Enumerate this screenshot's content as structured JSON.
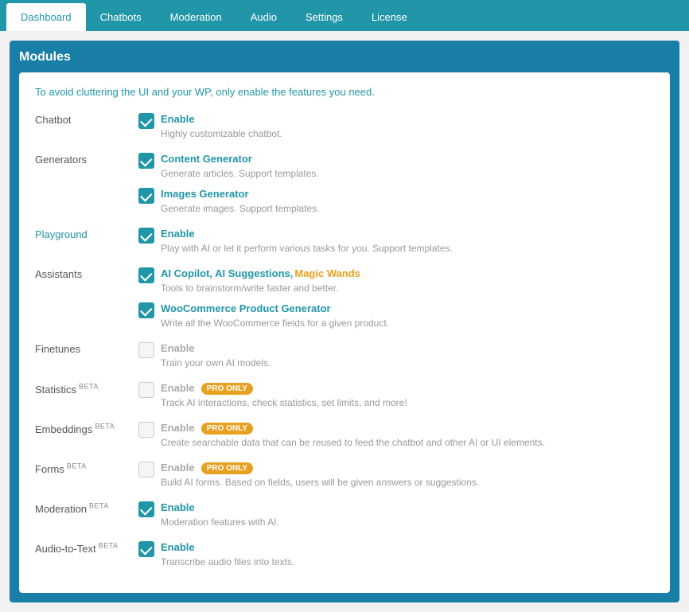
{
  "tabs": [
    {
      "label": "Dashboard",
      "active": false
    },
    {
      "label": "Chatbots",
      "active": false
    },
    {
      "label": "Moderation",
      "active": true
    },
    {
      "label": "Audio",
      "active": false
    },
    {
      "label": "Settings",
      "active": false
    },
    {
      "label": "License",
      "active": false
    }
  ],
  "panel": {
    "title": "Modules",
    "intro": "To avoid cluttering the UI and your WP, only enable the features you need."
  },
  "modules": [
    {
      "id": "chatbot",
      "label": "Chatbot",
      "beta": false,
      "controls": [
        {
          "checked": true,
          "title": "Enable",
          "desc": "Highly customizable chatbot.",
          "pro": false,
          "magic": false
        }
      ]
    },
    {
      "id": "generators",
      "label": "Generators",
      "beta": false,
      "controls": [
        {
          "checked": true,
          "title": "Content Generator",
          "desc": "Generate articles. Support templates.",
          "pro": false,
          "magic": false
        },
        {
          "checked": true,
          "title": "Images Generator",
          "desc": "Generate images. Support templates.",
          "pro": false,
          "magic": false
        }
      ]
    },
    {
      "id": "playground",
      "label": "Playground",
      "beta": false,
      "controls": [
        {
          "checked": true,
          "title": "Enable",
          "desc": "Play with AI or let it perform various tasks for you. Support templates.",
          "pro": false,
          "magic": false
        }
      ]
    },
    {
      "id": "assistants",
      "label": "Assistants",
      "beta": false,
      "controls": [
        {
          "checked": true,
          "title_parts": [
            "AI Copilot, AI Suggestions, ",
            "Magic Wands"
          ],
          "magic_wands": true,
          "desc": "Tools to brainstorm/write faster and better.",
          "pro": false,
          "magic": false
        },
        {
          "checked": true,
          "title": "WooCommerce Product Generator",
          "desc": "Write all the WooCommerce fields for a given product.",
          "pro": false,
          "magic": false
        }
      ]
    },
    {
      "id": "finetunes",
      "label": "Finetunes",
      "beta": false,
      "controls": [
        {
          "checked": false,
          "title": "Enable",
          "desc": "Train your own AI models.",
          "pro": false,
          "magic": false
        }
      ]
    },
    {
      "id": "statistics",
      "label": "Statistics",
      "beta": true,
      "controls": [
        {
          "checked": false,
          "title": "Enable",
          "desc": "Track AI interactions, check statistics, set limits, and more!",
          "pro": true,
          "magic": false
        }
      ]
    },
    {
      "id": "embeddings",
      "label": "Embeddings",
      "beta": true,
      "controls": [
        {
          "checked": false,
          "title": "Enable",
          "desc": "Create searchable data that can be reused to feed the chatbot and other AI or UI elements.",
          "pro": true,
          "magic": false
        }
      ]
    },
    {
      "id": "forms",
      "label": "Forms",
      "beta": true,
      "controls": [
        {
          "checked": false,
          "title": "Enable",
          "desc": "Build AI forms. Based on fields, users will be given answers or suggestions.",
          "pro": true,
          "magic": false
        }
      ]
    },
    {
      "id": "moderation",
      "label": "Moderation",
      "beta": true,
      "controls": [
        {
          "checked": true,
          "title": "Enable",
          "desc": "Moderation features with AI.",
          "pro": false,
          "magic": false
        }
      ]
    },
    {
      "id": "audio-to-text",
      "label": "Audio-to-Text",
      "beta": true,
      "controls": [
        {
          "checked": true,
          "title": "Enable",
          "desc": "Transcribe audio files into texts.",
          "pro": false,
          "magic": false
        }
      ]
    }
  ],
  "badges": {
    "pro_only": "PRO ONLY",
    "beta": "BETA"
  }
}
